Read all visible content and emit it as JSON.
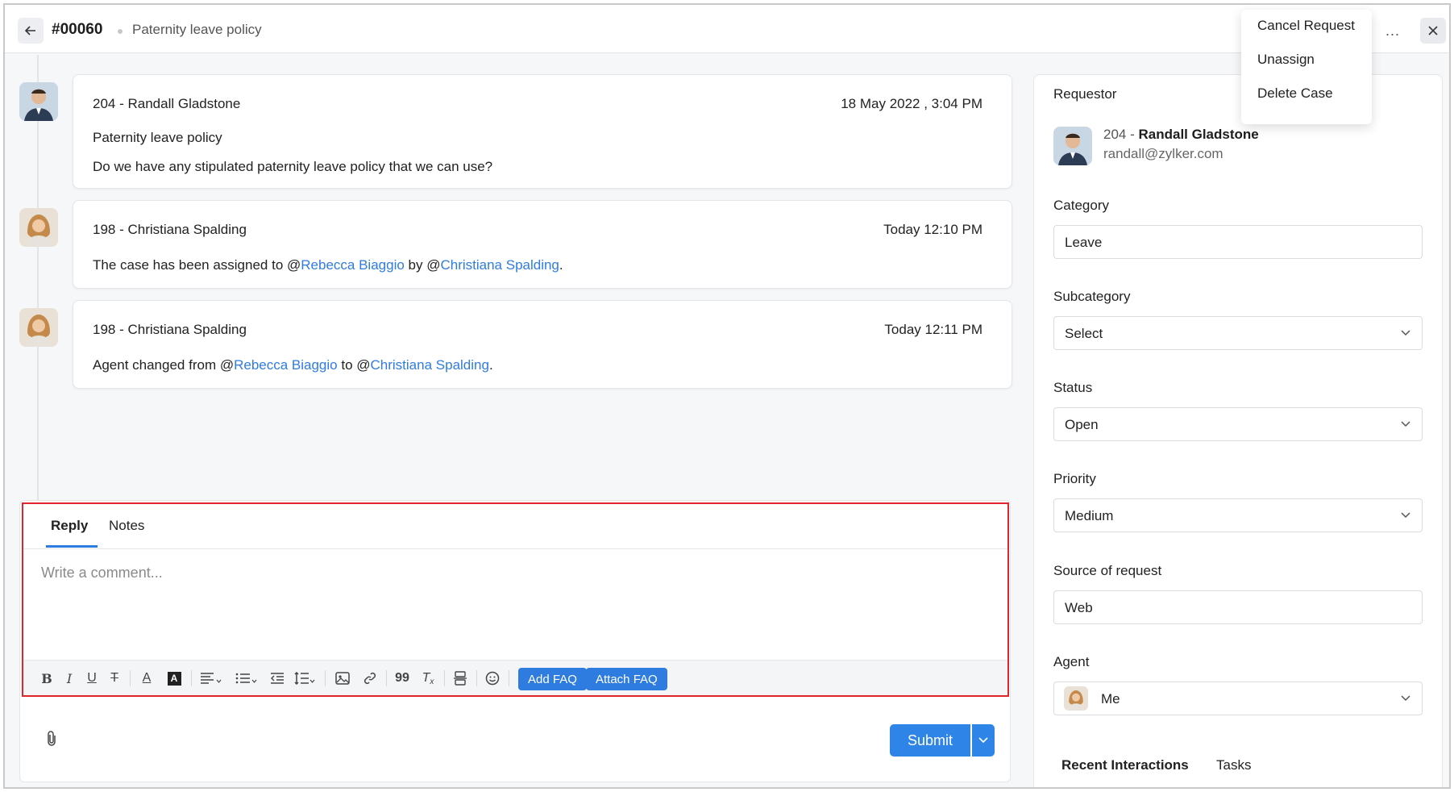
{
  "header": {
    "back_icon": "arrow-left-icon",
    "case_id": "#00060",
    "case_title": "Paternity leave policy",
    "more_label": "...",
    "close_icon": "close-icon"
  },
  "menu": {
    "items": [
      "Cancel Request",
      "Unassign",
      "Delete Case"
    ]
  },
  "messages": [
    {
      "author": "204 - Randall Gladstone",
      "time": "18 May 2022 , 3:04 PM",
      "subject": "Paternity leave policy",
      "body": "Do we have any stipulated paternity leave policy that we can use?"
    },
    {
      "author": "198 - Christiana Spalding",
      "time": "Today 12:10 PM",
      "pre": "The case has been assigned to @",
      "mention1": "Rebecca Biaggio",
      "mid": " by @",
      "mention2": "Christiana Spalding",
      "post": "."
    },
    {
      "author": "198 - Christiana Spalding",
      "time": "Today 12:11 PM",
      "pre": "Agent changed from @",
      "mention1": "Rebecca Biaggio",
      "mid": " to @",
      "mention2": "Christiana Spalding",
      "post": "."
    }
  ],
  "composer": {
    "tabs": [
      "Reply",
      "Notes"
    ],
    "placeholder": "Write a comment...",
    "add_faq": "Add FAQ",
    "attach_faq": "Attach FAQ",
    "submit": "Submit"
  },
  "panel": {
    "requestor_label": "Requestor",
    "requestor_id": "204",
    "requestor_name": "Randall Gladstone",
    "requestor_email": "randall@zylker.com",
    "category_label": "Category",
    "category_value": "Leave",
    "subcategory_label": "Subcategory",
    "subcategory_value": "Select",
    "status_label": "Status",
    "status_value": "Open",
    "priority_label": "Priority",
    "priority_value": "Medium",
    "source_label": "Source of request",
    "source_value": "Web",
    "agent_label": "Agent",
    "agent_value": "Me",
    "tabs": [
      "Recent Interactions",
      "Tasks"
    ]
  },
  "colors": {
    "accent": "#2f7ce0",
    "highlight_border": "#e0262b"
  }
}
